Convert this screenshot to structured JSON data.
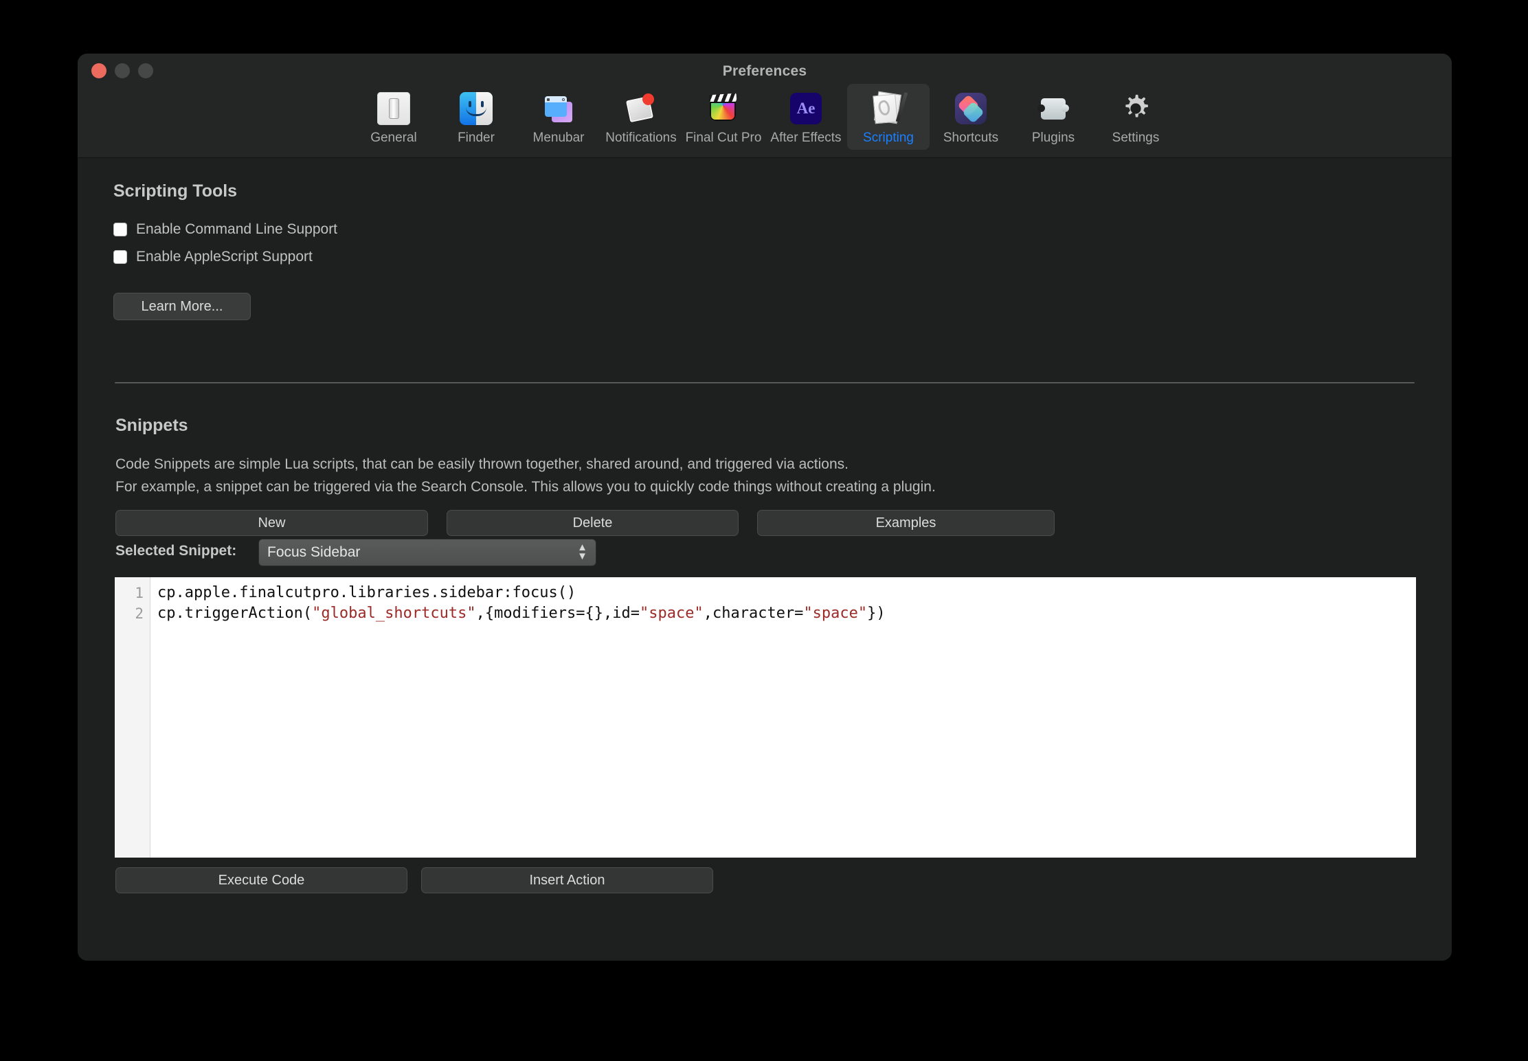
{
  "window": {
    "title": "Preferences",
    "traffic_lights": [
      "close",
      "minimize",
      "maximize"
    ]
  },
  "toolbar": {
    "items": [
      {
        "label": "General",
        "icon": "general-icon",
        "selected": false
      },
      {
        "label": "Finder",
        "icon": "finder-icon",
        "selected": false
      },
      {
        "label": "Menubar",
        "icon": "menubar-icon",
        "selected": false
      },
      {
        "label": "Notifications",
        "icon": "notifications-icon",
        "selected": false
      },
      {
        "label": "Final Cut Pro",
        "icon": "final-cut-pro-icon",
        "selected": false
      },
      {
        "label": "After Effects",
        "icon": "after-effects-icon",
        "selected": false
      },
      {
        "label": "Scripting",
        "icon": "scripting-icon",
        "selected": true
      },
      {
        "label": "Shortcuts",
        "icon": "shortcuts-icon",
        "selected": false
      },
      {
        "label": "Plugins",
        "icon": "plugins-icon",
        "selected": false
      },
      {
        "label": "Settings",
        "icon": "settings-gear-icon",
        "selected": false
      }
    ],
    "after_effects_glyph": "Ae"
  },
  "scripting_tools": {
    "title": "Scripting Tools",
    "checkboxes": [
      {
        "label": "Enable Command Line Support",
        "checked": false
      },
      {
        "label": "Enable AppleScript Support",
        "checked": false
      }
    ],
    "learn_more_label": "Learn More..."
  },
  "snippets": {
    "title": "Snippets",
    "description_line1": "Code Snippets are simple Lua scripts, that can be easily thrown together, shared around, and triggered via actions.",
    "description_line2": "For example, a snippet can be triggered via the Search Console. This allows you to quickly code things without creating a plugin.",
    "buttons": {
      "new": "New",
      "delete": "Delete",
      "examples": "Examples"
    },
    "selected_label": "Selected Snippet:",
    "selected_value": "Focus Sidebar",
    "editor": {
      "line_numbers": [
        "1",
        "2"
      ],
      "line1": {
        "seg1": "cp.apple.finalcutpro.libraries.sidebar:focus()"
      },
      "line2": {
        "seg1": "cp.triggerAction(",
        "str1": "\"global_shortcuts\"",
        "seg2": ",{modifiers={},id=",
        "str2": "\"space\"",
        "seg3": ",character=",
        "str3": "\"space\"",
        "seg4": "})"
      }
    },
    "bottom_buttons": {
      "execute": "Execute Code",
      "insert": "Insert Action"
    }
  },
  "colors": {
    "window_bg": "#1e1f1f",
    "toolbar_bg": "#242525",
    "accent_selected_text": "#1a80ff",
    "editor_bg": "#ffffff",
    "string_literal": "#9c2a26",
    "close_button": "#ec6a5e"
  }
}
